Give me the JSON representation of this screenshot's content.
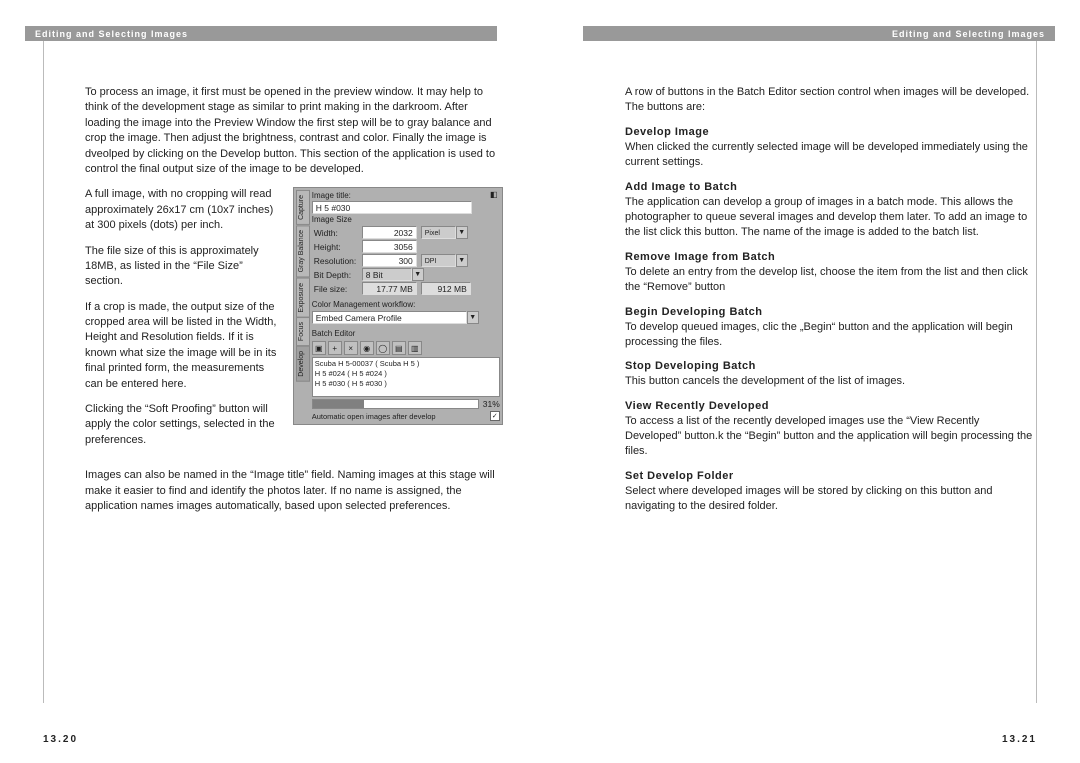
{
  "header_title": "Editing and Selecting Images",
  "left": {
    "page_num": "13.20",
    "p1": "To process an image, it first must be opened in the preview window. It may help to think of the development stage as similar to print making in the darkroom. After loading the image into the Preview Window the first step will be to gray balance and crop the image. Then adjust the brightness, contrast and color. Finally the image is dveolped by clicking on the Develop button. This section of the application is used to control the final output size of the image to be developed.",
    "p2": "A full image, with no cropping will read approximately 26x17 cm (10x7 inches) at 300 pixels (dots) per inch.",
    "p3": "The file size of this is approximately 18MB, as listed in the “File Size” section.",
    "p4": "If a crop is made, the output size of the cropped area will be listed in the Width, Height and Resolution fields. If it is known what size the image will be in its final printed form, the measurements can be entered here.",
    "p5": "Clicking the “Soft Proofing” button will apply the color settings, selected in the preferences.",
    "p6": "Images can also be named in the “Image title” field. Naming images at this stage will make it easier to find and identify the photos later. If no name is assigned, the application names images automatically, based upon selected preferences."
  },
  "right": {
    "page_num": "13.21",
    "intro": "A row of buttons in the Batch Editor section control when images will be developed. The buttons are:",
    "sections": [
      {
        "h": "Develop Image",
        "t": "When clicked the currently selected image will be developed immediately using the current settings."
      },
      {
        "h": "Add Image to Batch",
        "t": "The application can develop a group of images in a batch mode. This allows the photographer to queue several images and develop them later. To add an image to the list click this button. The name of the image is added to the batch list."
      },
      {
        "h": "Remove Image from Batch",
        "t": "To delete an entry from the develop list, choose the item from the list and then click the “Remove” button"
      },
      {
        "h": "Begin Developing Batch",
        "t": "To develop queued images, clic the „Begin“ button and the application will begin processing the files."
      },
      {
        "h": "Stop Developing Batch",
        "t": "This button cancels the development of the list of images."
      },
      {
        "h": "View Recently Developed",
        "t": "To access a list of the recently developed images use the “View Recently Developed” button.k the “Begin” button and the application will begin processing the files."
      },
      {
        "h": "Set Develop Folder",
        "t": "Select where developed images will be stored by clicking on this button and navigating to the desired folder."
      }
    ]
  },
  "screenshot": {
    "tabs": [
      "Capture",
      "Gray Balance",
      "Exposure",
      "Focus",
      "Develop"
    ],
    "image_title_label": "Image title:",
    "image_title_value": "H 5 #030",
    "image_size_label": "Image Size",
    "width_label": "Width:",
    "width_value": "2032",
    "height_label": "Height:",
    "height_value": "3056",
    "resolution_label": "Resolution:",
    "resolution_value": "300",
    "pixel_unit": "Pixel",
    "dpi_unit": "DPI",
    "bit_depth_label": "Bit Depth:",
    "bit_depth_value": "8 Bit",
    "file_size_label": "File size:",
    "file_size_v1": "17.77 MB",
    "file_size_v2": "912 MB",
    "cm_workflow_label": "Color Management workflow:",
    "cm_workflow_value": "Embed Camera Profile",
    "batch_editor_label": "Batch Editor",
    "list_items": [
      "Scuba H 5-00037 ( Scuba H 5 )",
      "H 5 #024 ( H 5 #024 )",
      "H 5 #030 ( H 5 #030 )"
    ],
    "progress": "31%",
    "auto_open_label": "Automatic open images after develop"
  }
}
